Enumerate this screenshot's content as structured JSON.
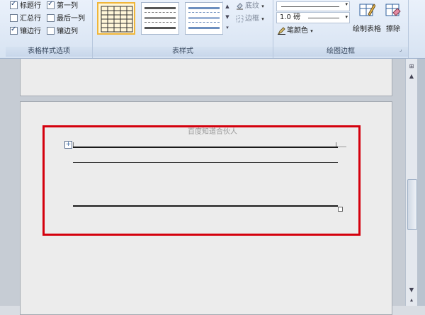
{
  "ribbon": {
    "style_options": {
      "label": "表格样式选项",
      "options": [
        {
          "label": "标题行",
          "checked": true
        },
        {
          "label": "第一列",
          "checked": true
        },
        {
          "label": "汇总行",
          "checked": false
        },
        {
          "label": "最后一列",
          "checked": false
        },
        {
          "label": "镶边行",
          "checked": true
        },
        {
          "label": "镶边列",
          "checked": false
        }
      ]
    },
    "table_styles": {
      "label": "表样式",
      "shading_label": "底纹",
      "borders_label": "边框"
    },
    "draw_borders": {
      "label": "绘图边框",
      "line_weight": "1.0 磅",
      "pen_color_label": "笔颜色",
      "draw_table_label": "绘制表格",
      "eraser_label": "擦除"
    }
  },
  "document": {
    "watermark": "百度知道合伙人"
  },
  "colors": {
    "highlight": "#d4000d",
    "ribbon_bg": "#dfe8f5",
    "selected_style": "#f0b63a"
  }
}
